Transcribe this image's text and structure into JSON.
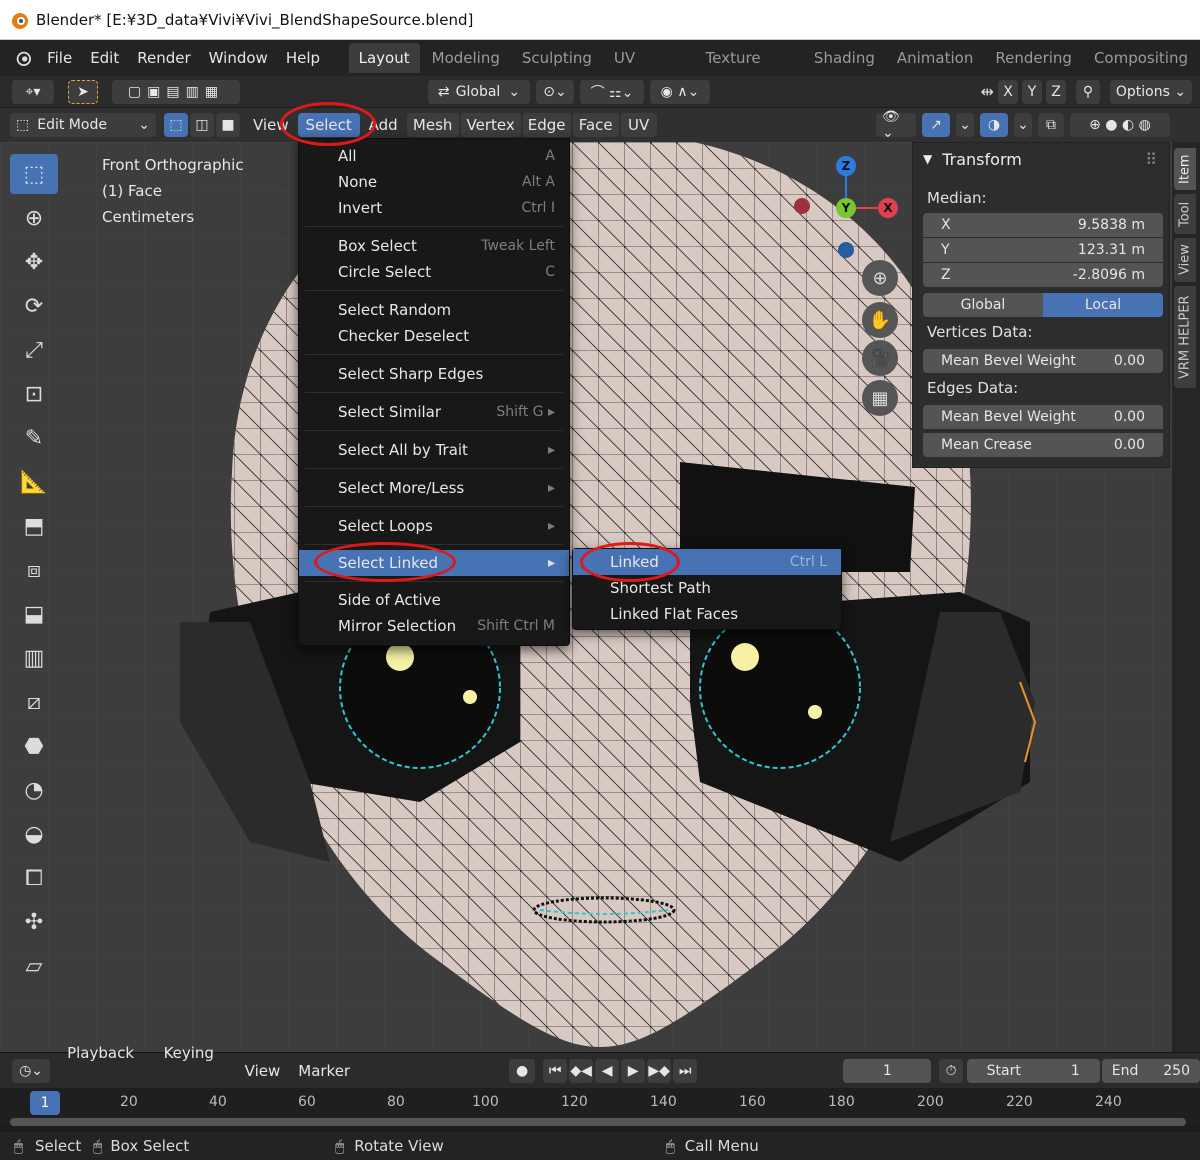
{
  "window": {
    "title": "Blender* [E:¥3D_data¥Vivi¥Vivi_BlendShapeSource.blend]"
  },
  "menu": {
    "file": "File",
    "edit": "Edit",
    "render": "Render",
    "window": "Window",
    "help": "Help"
  },
  "workspaces": [
    "Layout",
    "Modeling",
    "Sculpting",
    "UV Editing",
    "Texture Paint",
    "Shading",
    "Animation",
    "Rendering",
    "Compositing"
  ],
  "header": {
    "orientation": "Global",
    "axes": [
      "X",
      "Y",
      "Z"
    ],
    "options": "Options"
  },
  "viewport_header": {
    "mode": "Edit Mode",
    "menus": [
      "View",
      "Select",
      "Add",
      "Mesh",
      "Vertex",
      "Edge",
      "Face",
      "UV"
    ]
  },
  "viewport_info": {
    "view": "Front Orthographic",
    "object": "(1) Face",
    "units": "Centimeters"
  },
  "select_menu": {
    "items": [
      {
        "label": "All",
        "shortcut": "A"
      },
      {
        "label": "None",
        "shortcut": "Alt A"
      },
      {
        "label": "Invert",
        "shortcut": "Ctrl I"
      },
      {
        "label": "Box Select",
        "shortcut": "Tweak Left"
      },
      {
        "label": "Circle Select",
        "shortcut": "C"
      },
      {
        "label": "Select Random",
        "shortcut": ""
      },
      {
        "label": "Checker Deselect",
        "shortcut": ""
      },
      {
        "label": "Select Sharp Edges",
        "shortcut": ""
      },
      {
        "label": "Select Similar",
        "shortcut": "Shift G"
      },
      {
        "label": "Select All by Trait",
        "shortcut": ""
      },
      {
        "label": "Select More/Less",
        "shortcut": ""
      },
      {
        "label": "Select Loops",
        "shortcut": ""
      },
      {
        "label": "Select Linked",
        "shortcut": ""
      },
      {
        "label": "Side of Active",
        "shortcut": ""
      },
      {
        "label": "Mirror Selection",
        "shortcut": "Shift Ctrl M"
      }
    ]
  },
  "linked_submenu": {
    "items": [
      {
        "label": "Linked",
        "shortcut": "Ctrl L"
      },
      {
        "label": "Shortest Path",
        "shortcut": ""
      },
      {
        "label": "Linked Flat Faces",
        "shortcut": ""
      }
    ]
  },
  "transform_panel": {
    "title": "Transform",
    "median": "Median:",
    "x": {
      "label": "X",
      "value": "9.5838 m"
    },
    "y": {
      "label": "Y",
      "value": "123.31 m"
    },
    "z": {
      "label": "Z",
      "value": "-2.8096 m"
    },
    "global": "Global",
    "local": "Local",
    "vertices_data": "Vertices Data:",
    "edges_data": "Edges Data:",
    "mean_bevel_weight_v": {
      "label": "Mean Bevel Weight",
      "value": "0.00"
    },
    "mean_bevel_weight_e": {
      "label": "Mean Bevel Weight",
      "value": "0.00"
    },
    "mean_crease": {
      "label": "Mean Crease",
      "value": "0.00"
    }
  },
  "sidebar_tabs": [
    "Item",
    "Tool",
    "View",
    "VRM HELPER"
  ],
  "gizmo": {
    "z": "Z",
    "y": "Y",
    "x": "X"
  },
  "timeline": {
    "playback": "Playback",
    "keying": "Keying",
    "view": "View",
    "marker": "Marker",
    "current_frame": "1",
    "start_label": "Start",
    "start": "1",
    "end_label": "End",
    "end": "250"
  },
  "frame_ruler": {
    "current": "1",
    "ticks": [
      "20",
      "40",
      "60",
      "80",
      "100",
      "120",
      "140",
      "160",
      "180",
      "200",
      "220",
      "240"
    ]
  },
  "statusbar": {
    "select": "Select",
    "box_select": "Box Select",
    "rotate_view": "Rotate View",
    "call_menu": "Call Menu"
  },
  "colors": {
    "accent": "#4772b3",
    "highlight_ring": "#e01818",
    "bg_dark": "#181818"
  }
}
